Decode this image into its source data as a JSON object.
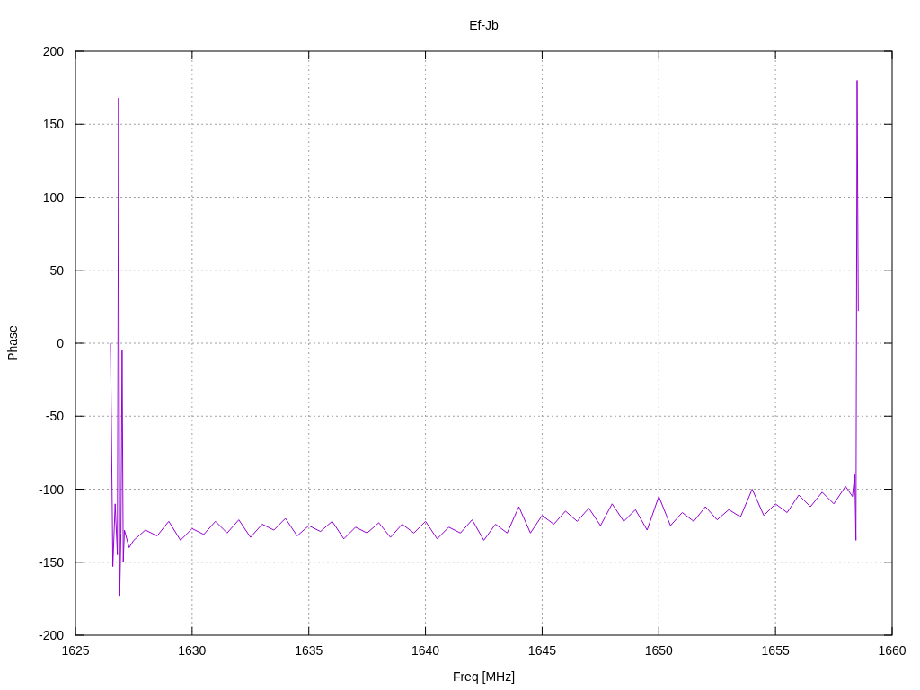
{
  "chart_data": {
    "type": "line",
    "grid": true,
    "title": "Ef-Jb",
    "xlabel": "Freq [MHz]",
    "ylabel": "Phase",
    "xlim": [
      1625,
      1660
    ],
    "ylim": [
      -200,
      200
    ],
    "xticks": [
      1625,
      1630,
      1635,
      1640,
      1645,
      1650,
      1655,
      1660
    ],
    "yticks": [
      -200,
      -150,
      -100,
      -50,
      0,
      50,
      100,
      150,
      200
    ],
    "x": [
      1626.5,
      1626.55,
      1626.6,
      1626.7,
      1626.8,
      1626.85,
      1626.9,
      1626.95,
      1627.0,
      1627.05,
      1627.1,
      1627.3,
      1627.5,
      1628,
      1628.5,
      1629,
      1629.5,
      1630,
      1630.5,
      1631,
      1631.5,
      1632,
      1632.5,
      1633,
      1633.5,
      1634,
      1634.5,
      1635,
      1635.5,
      1636,
      1636.5,
      1637,
      1637.5,
      1638,
      1638.5,
      1639,
      1639.5,
      1640,
      1640.5,
      1641,
      1641.5,
      1642,
      1642.5,
      1643,
      1643.5,
      1644,
      1644.5,
      1645,
      1645.5,
      1646,
      1646.5,
      1647,
      1647.5,
      1648,
      1648.5,
      1649,
      1649.5,
      1650,
      1650.5,
      1651,
      1651.5,
      1652,
      1652.5,
      1653,
      1653.5,
      1654,
      1654.5,
      1655,
      1655.5,
      1656,
      1656.5,
      1657,
      1657.5,
      1658,
      1658.3,
      1658.4,
      1658.45,
      1658.5,
      1658.55
    ],
    "series": [
      {
        "color": "#9400d3",
        "values": [
          0,
          -75,
          -153,
          -110,
          -145,
          168,
          -173,
          -130,
          -5,
          -150,
          -128,
          -140,
          -135,
          -128,
          -132,
          -122,
          -135,
          -127,
          -131,
          -122,
          -130,
          -121,
          -133,
          -124,
          -128,
          -120,
          -132,
          -125,
          -129,
          -122,
          -134,
          -126,
          -130,
          -123,
          -133,
          -124,
          -130,
          -122,
          -134,
          -126,
          -130,
          -121,
          -135,
          -124,
          -130,
          -112,
          -130,
          -118,
          -124,
          -115,
          -122,
          -113,
          -125,
          -110,
          -122,
          -114,
          -128,
          -105,
          -125,
          -116,
          -122,
          -112,
          -121,
          -114,
          -119,
          -100,
          -118,
          -110,
          -116,
          -104,
          -112,
          -102,
          -110,
          -98,
          -105,
          -90,
          -135,
          180,
          22
        ]
      }
    ]
  }
}
